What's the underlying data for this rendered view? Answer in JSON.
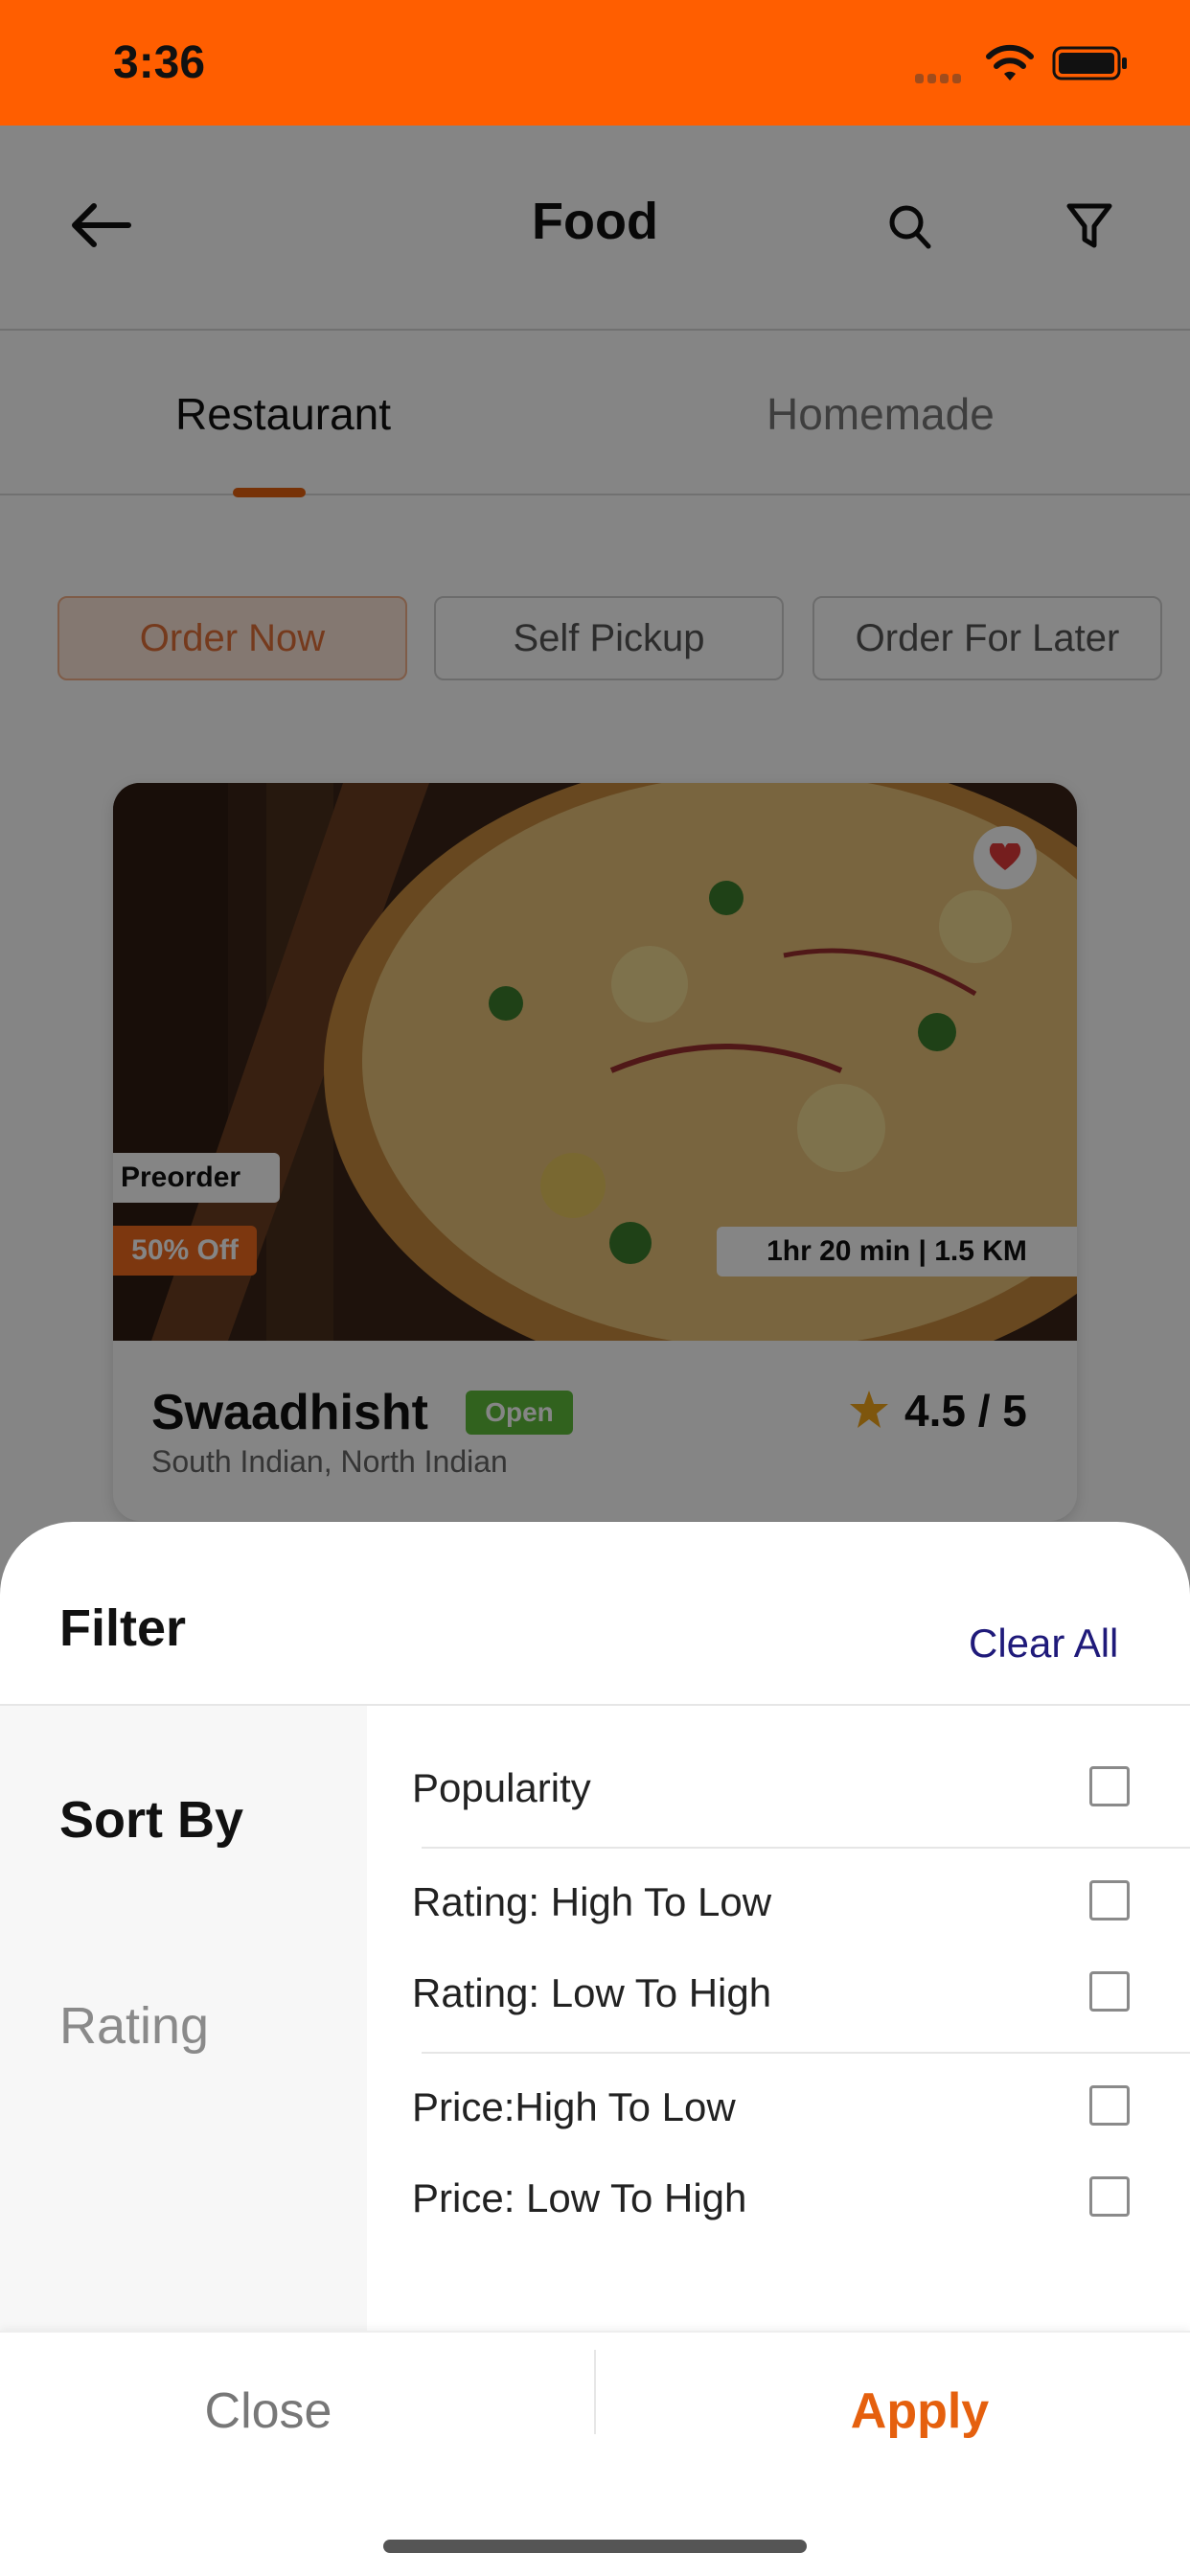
{
  "status_bar": {
    "time": "3:36",
    "color": "#FF5E00"
  },
  "header": {
    "title": "Food",
    "back_icon": "arrow-left-icon",
    "search_icon": "search-icon",
    "filter_icon": "funnel-icon"
  },
  "tabs": [
    {
      "label": "Restaurant",
      "active": true
    },
    {
      "label": "Homemade",
      "active": false
    }
  ],
  "chips": [
    {
      "label": "Order Now",
      "selected": true
    },
    {
      "label": "Self Pickup",
      "selected": false
    },
    {
      "label": "Order For Later",
      "selected": false
    }
  ],
  "card": {
    "name": "Swaadhisht",
    "status": "Open",
    "cuisine": "South Indian, North Indian",
    "rating": "4.5 / 5",
    "preorder": "Preorder",
    "discount": "50% Off",
    "eta": "1hr 20 min  |  1.5 KM"
  },
  "filter": {
    "title": "Filter",
    "clear_all": "Clear All",
    "sidebar": [
      {
        "label": "Sort By",
        "active": true
      },
      {
        "label": "Rating",
        "active": false
      }
    ],
    "options": [
      {
        "label": "Popularity",
        "checked": false
      },
      {
        "label": "Rating: High To Low",
        "checked": false
      },
      {
        "label": "Rating: Low To High",
        "checked": false
      },
      {
        "label": "Price:High To Low",
        "checked": false
      },
      {
        "label": "Price: Low To High",
        "checked": false
      }
    ],
    "close_label": "Close",
    "apply_label": "Apply"
  },
  "colors": {
    "accent": "#E5600E",
    "open_badge": "#5EBD3B",
    "link": "#1f1a7a"
  }
}
